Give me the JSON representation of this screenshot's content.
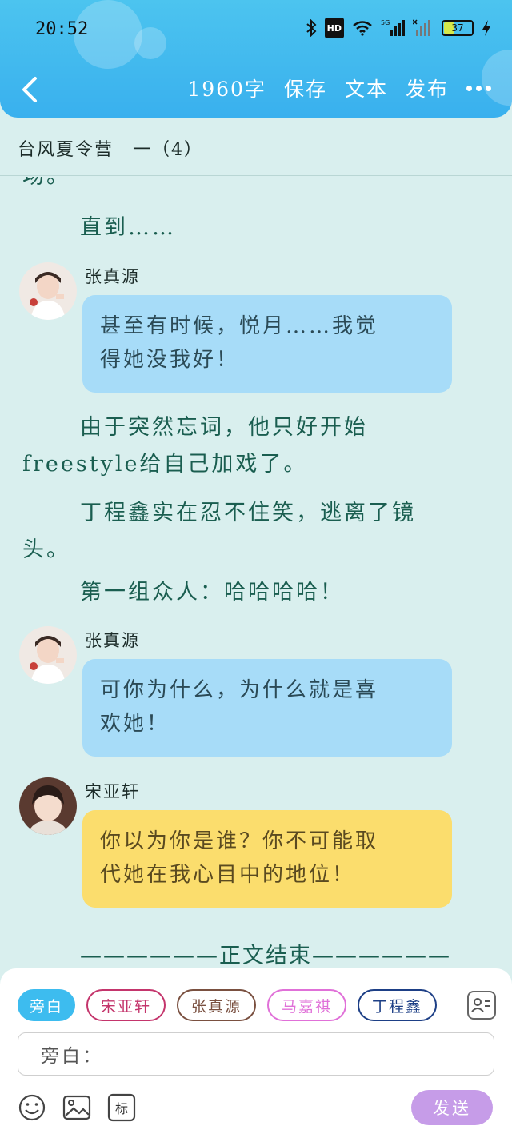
{
  "status_bar": {
    "time": "20:52",
    "hd_label": "HD",
    "network_label": "5G",
    "battery_level": "37",
    "battery_fraction": 0.37
  },
  "toolbar": {
    "word_count": "1960字",
    "save_label": "保存",
    "text_label": "文本",
    "publish_label": "发布"
  },
  "chapter": {
    "title": "台风夏令营　一（4）"
  },
  "content": {
    "fragment": "场。",
    "para_1": "直到……",
    "messages": [
      {
        "speaker": "张真源",
        "text_line1": "甚至有时候，悦月……我觉",
        "text_line2": "得她没我好！",
        "style": "blue"
      },
      {
        "speaker": "张真源",
        "text_line1": "可你为什么，为什么就是喜",
        "text_line2": "欢她！",
        "style": "blue"
      },
      {
        "speaker": "宋亚轩",
        "text_line1": "你以为你是谁？你不可能取",
        "text_line2": "代她在我心目中的地位！",
        "style": "yellow"
      }
    ],
    "para_2_line1": "由于突然忘词，他只好开始",
    "para_2_line2": "freestyle给自己加戏了。",
    "para_3_line1": "丁程鑫实在忍不住笑，逃离了镜",
    "para_3_line2": "头。",
    "para_4": "第一组众人：哈哈哈哈！",
    "ending": "——————正文结束——————"
  },
  "composer": {
    "roles": [
      {
        "label": "旁白",
        "color": "#3dbcef",
        "active": true
      },
      {
        "label": "宋亚轩",
        "color": "#c4356c",
        "active": false
      },
      {
        "label": "张真源",
        "color": "#7a5040",
        "active": false
      },
      {
        "label": "马嘉祺",
        "color": "#e070d8",
        "active": false
      },
      {
        "label": "丁程鑫",
        "color": "#1d3f86",
        "active": false
      }
    ],
    "input_label": "旁白：",
    "tag_label": "标",
    "send_label": "发送"
  },
  "icons": [
    "back-chevron-icon",
    "more-icon",
    "bluetooth-icon",
    "wifi-icon",
    "signal-icon",
    "emoji-icon",
    "image-icon",
    "tag-icon",
    "contacts-icon"
  ],
  "colors": {
    "header": "#3fb9ef",
    "background": "#d9efee",
    "narration_text": "#1a5e50",
    "bubble_blue": "#a7dcf8",
    "bubble_yellow": "#fbdd6d",
    "send": "#c69ce8"
  }
}
